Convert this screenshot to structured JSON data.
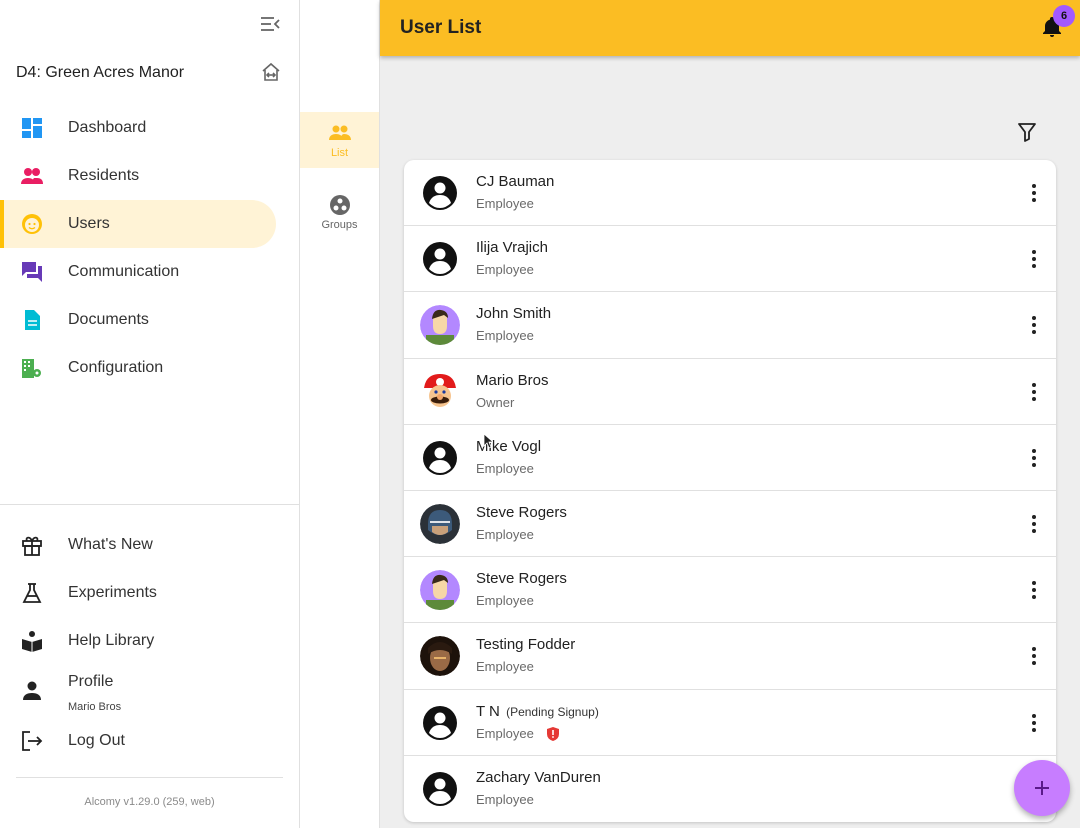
{
  "sidebar": {
    "property_name": "D4: Green Acres Manor",
    "nav": [
      {
        "label": "Dashboard",
        "icon": "dashboard-icon",
        "color": "#2196f3"
      },
      {
        "label": "Residents",
        "icon": "residents-icon",
        "color": "#e91e63"
      },
      {
        "label": "Users",
        "icon": "users-face-icon",
        "color": "#ffc107"
      },
      {
        "label": "Communication",
        "icon": "chat-icon",
        "color": "#673ab7"
      },
      {
        "label": "Documents",
        "icon": "document-icon",
        "color": "#00bcd4"
      },
      {
        "label": "Configuration",
        "icon": "building-gear-icon",
        "color": "#4caf50"
      }
    ],
    "bottom_nav": [
      {
        "label": "What's New",
        "icon": "gift-icon"
      },
      {
        "label": "Experiments",
        "icon": "flask-icon"
      },
      {
        "label": "Help Library",
        "icon": "book-icon"
      },
      {
        "label": "Profile",
        "sub": "Mario Bros",
        "icon": "person-icon"
      },
      {
        "label": "Log Out",
        "icon": "logout-icon"
      }
    ],
    "version": "Alcomy v1.29.0 (259, web)"
  },
  "rail": {
    "items": [
      {
        "label": "List",
        "icon": "people-icon"
      },
      {
        "label": "Groups",
        "icon": "groups-icon"
      }
    ]
  },
  "header": {
    "title": "User List",
    "notification_count": "6"
  },
  "users": [
    {
      "name": "CJ Bauman",
      "role": "Employee",
      "avatar": "default"
    },
    {
      "name": "Ilija Vrajich",
      "role": "Employee",
      "avatar": "default"
    },
    {
      "name": "John Smith",
      "role": "Employee",
      "avatar": "cartoon"
    },
    {
      "name": "Mario Bros",
      "role": "Owner",
      "avatar": "mario"
    },
    {
      "name": "Mike Vogl",
      "role": "Employee",
      "avatar": "default"
    },
    {
      "name": "Steve Rogers",
      "role": "Employee",
      "avatar": "photo-helmet"
    },
    {
      "name": "Steve Rogers",
      "role": "Employee",
      "avatar": "cartoon"
    },
    {
      "name": "Testing Fodder",
      "role": "Employee",
      "avatar": "photo-face"
    },
    {
      "name": "T N",
      "pending": "(Pending Signup)",
      "role": "Employee",
      "avatar": "default",
      "alert": true
    },
    {
      "name": "Zachary VanDuren",
      "role": "Employee",
      "avatar": "default"
    }
  ],
  "colors": {
    "accent": "#fbbd23",
    "active_bg": "#fff3d6",
    "fab": "#c77dff",
    "badge": "#a259ff"
  }
}
